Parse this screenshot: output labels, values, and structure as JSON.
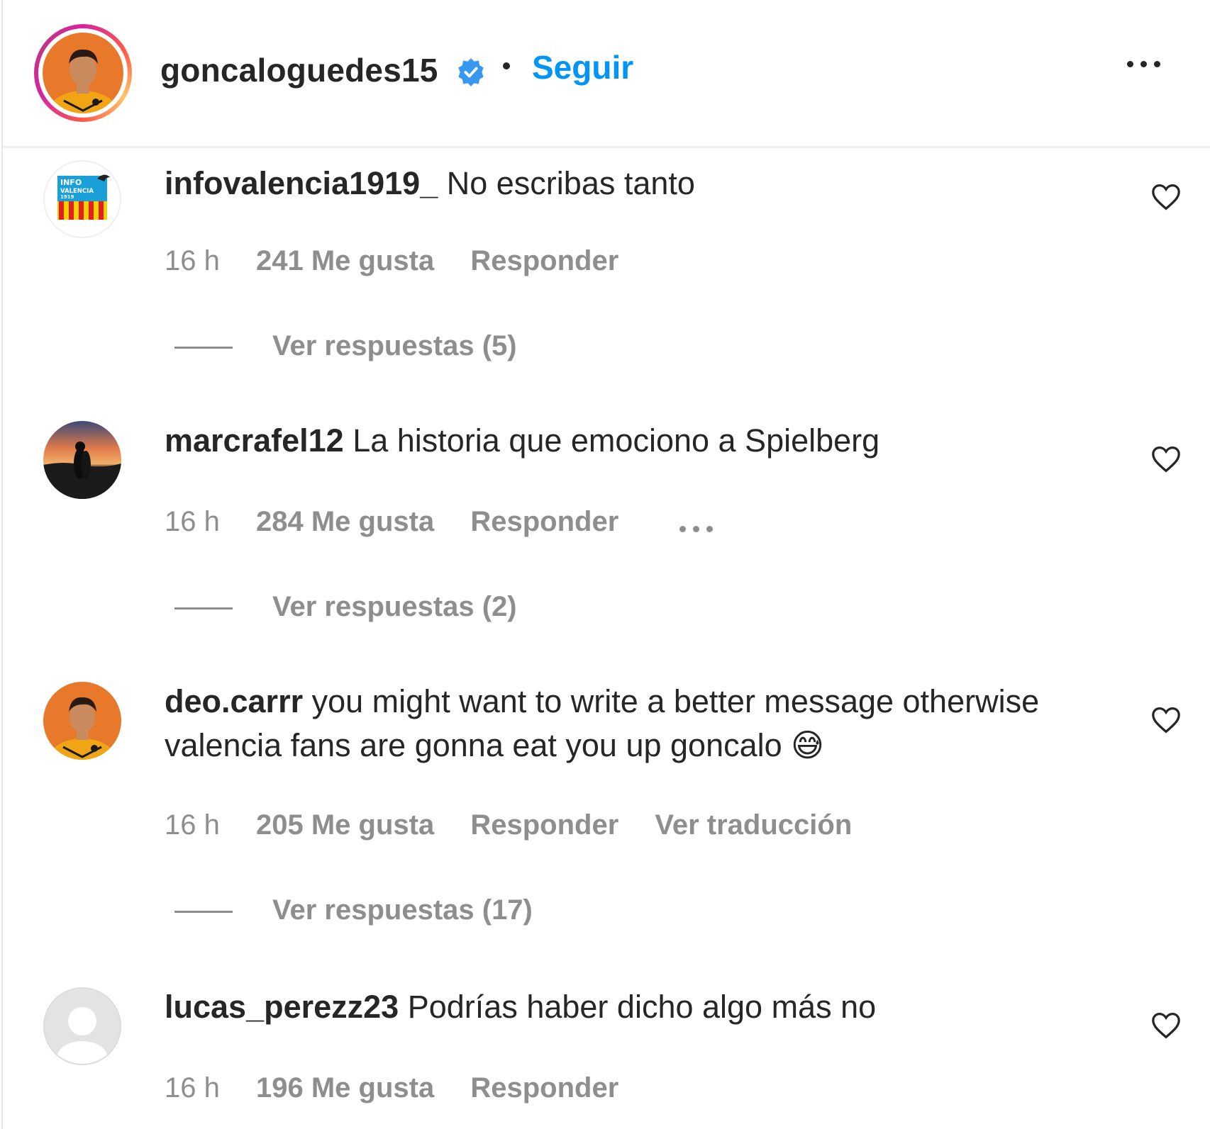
{
  "post_header": {
    "username": "goncaloguedes15",
    "follow_label": "Seguir",
    "colors": {
      "link_blue": "#0095f6",
      "verified_blue": "#3897f0"
    }
  },
  "comments": [
    {
      "username": "infovalencia1919_",
      "text": "No escribas tanto",
      "time": "16 h",
      "likes": "241 Me gusta",
      "reply_label": "Responder",
      "replies_label": "Ver respuestas (5)",
      "avatar_icon": "infovalencia-logo",
      "avatar_text": "INFO VALENCIA 1919"
    },
    {
      "username": "marcrafel12",
      "text": "La historia que emociono a Spielberg",
      "time": "16 h",
      "likes": "284 Me gusta",
      "reply_label": "Responder",
      "replies_label": "Ver respuestas (2)",
      "avatar_icon": "sunset-couple-photo"
    },
    {
      "username": "deo.carrr",
      "text": "you might want to write a better message otherwise valencia fans are gonna eat you up goncalo",
      "emoji": "😅",
      "time": "16 h",
      "likes": "205 Me gusta",
      "reply_label": "Responder",
      "translate_label": "Ver traducción",
      "replies_label": "Ver respuestas (17)",
      "avatar_icon": "player-photo"
    },
    {
      "username": "lucas_perezz23",
      "text": "Podrías haber dicho algo más no",
      "time": "16 h",
      "likes": "196 Me gusta",
      "reply_label": "Responder",
      "avatar_icon": "default-user-icon"
    }
  ]
}
